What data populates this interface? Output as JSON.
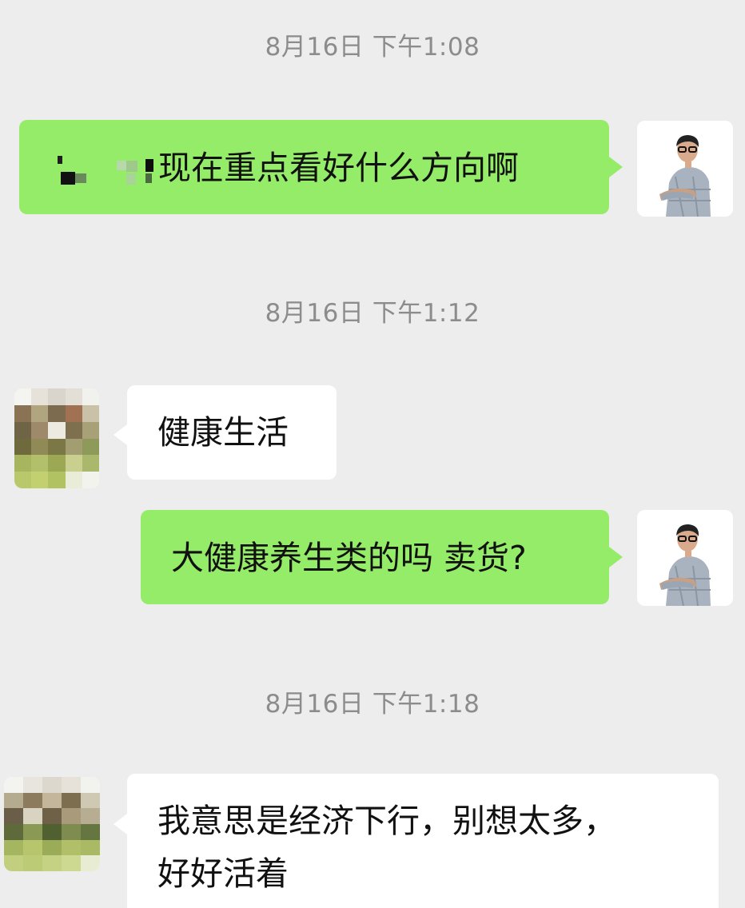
{
  "messages": [
    {
      "type": "timestamp",
      "text": "8月16日 下午1:08"
    },
    {
      "type": "sent",
      "text": "现在重点看好什么方向啊",
      "redacted_prefix": true
    },
    {
      "type": "timestamp",
      "text": "8月16日 下午1:12"
    },
    {
      "type": "received",
      "text": "健康生活"
    },
    {
      "type": "sent",
      "text": "大健康养生类的吗 卖货?"
    },
    {
      "type": "timestamp",
      "text": "8月16日 下午1:18"
    },
    {
      "type": "received",
      "line1": "我意思是经济下行，别想太多，",
      "line2": "好好活着"
    }
  ],
  "colors": {
    "background": "#ededed",
    "sent_bubble": "#95ec69",
    "received_bubble": "#ffffff",
    "timestamp_text": "#8c8c8c"
  },
  "icons": {
    "sender_avatar": "person-photo-avatar-icon",
    "contact_avatar": "pixelated-avatar-icon"
  }
}
